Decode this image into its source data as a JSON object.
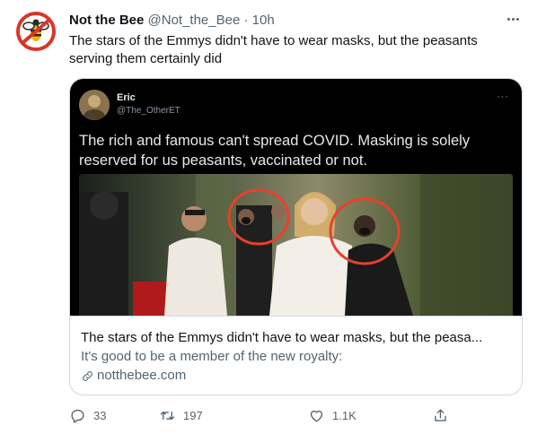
{
  "tweet": {
    "author_name": "Not the Bee",
    "author_handle": "@Not_the_Bee",
    "separator": "·",
    "time": "10h",
    "text": "The stars of the Emmys didn't have to wear masks, but the peasants serving them certainly did",
    "avatar_icon": "bee-logo-icon",
    "more_icon": "more-dots-icon"
  },
  "card": {
    "quoted_name": "Eric",
    "quoted_handle": "@The_OtherET",
    "quoted_more": "···",
    "quoted_text": "The rich and famous can't spread COVID. Masking is solely reserved for us peasants, vaccinated or not.",
    "title": "The stars of the Emmys didn't have to wear masks, but the peasa...",
    "description": "It's good to be a member of the new royalty:",
    "domain": "notthebee.com",
    "link_icon": "link-icon"
  },
  "actions": {
    "reply_count": "33",
    "retweet_count": "197",
    "like_count": "1.1K",
    "reply_icon": "reply-icon",
    "retweet_icon": "retweet-icon",
    "like_icon": "heart-icon",
    "share_icon": "share-icon"
  },
  "colors": {
    "text_primary": "#0f1419",
    "text_secondary": "#536471",
    "border": "#cfd9de",
    "logo_red": "#d8362a",
    "logo_yellow": "#f4b400",
    "circle_red": "#e8402d"
  }
}
